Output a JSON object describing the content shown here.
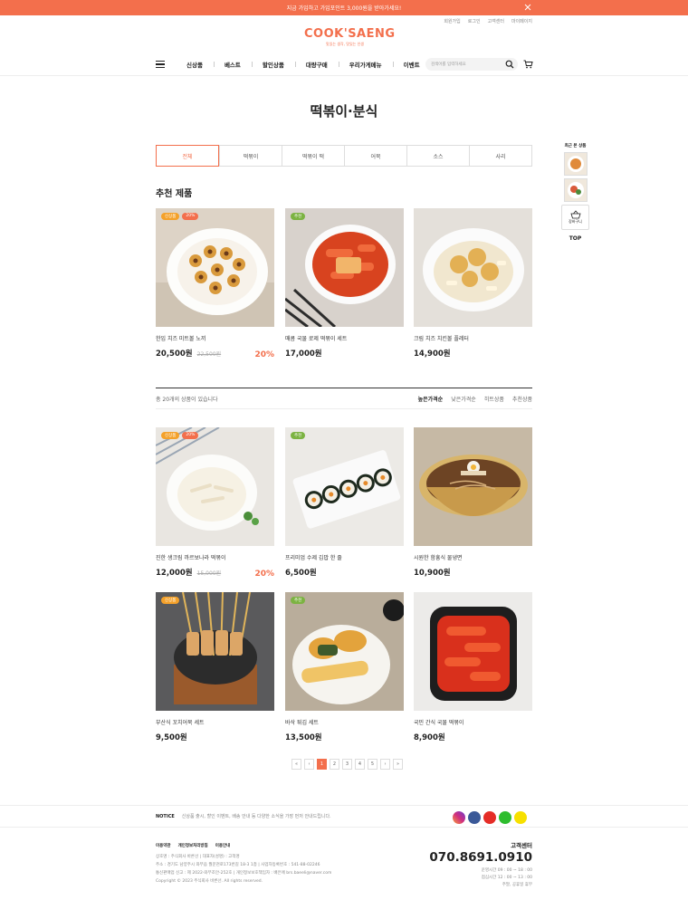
{
  "banner": {
    "text": "지금 가입하고 가입포인트 3,000원을 받아가세요!"
  },
  "util_links": [
    "회원가입",
    "로그인",
    "고객센터",
    "마이페이지"
  ],
  "logo": {
    "main": "COOK'SAENG",
    "sub": "맛있는 생각, 맛있는 인생"
  },
  "nav": [
    "신상품",
    "베스트",
    "할인상품",
    "대량구매",
    "우리가게메뉴",
    "이벤트"
  ],
  "search": {
    "placeholder": "검색어를 입력하세요"
  },
  "page_title": "떡볶이·분식",
  "tabs": [
    "전체",
    "떡볶이",
    "떡볶이 떡",
    "어묵",
    "소스",
    "사리"
  ],
  "rec_title": "추천 제품",
  "recommended": [
    {
      "name": "한입 치즈 미트볼 노끼",
      "price": "20,500원",
      "orig": "22,500원",
      "pct": "20%",
      "badges": [
        "신상품",
        "20%"
      ]
    },
    {
      "name": "매콤 국물 로제 떡볶이 세트",
      "price": "17,000원",
      "orig": "",
      "pct": "",
      "badges": [
        "추천"
      ]
    },
    {
      "name": "크림 치즈 치킨볼 플레터",
      "price": "14,900원",
      "orig": "",
      "pct": "",
      "badges": []
    }
  ],
  "count_text": "총 20개의 상품이 있습니다",
  "sorts": [
    "높은가격순",
    "낮은가격순",
    "히트상품",
    "추천상품"
  ],
  "products": [
    {
      "name": "진한 생크림 까르보나라 떡볶이",
      "price": "12,000원",
      "orig": "15,000원",
      "pct": "20%",
      "badges": [
        "신상품",
        "20%"
      ]
    },
    {
      "name": "프리미엄 수제 김밥 한 줄",
      "price": "6,500원",
      "orig": "",
      "pct": "",
      "badges": [
        "추천"
      ]
    },
    {
      "name": "시원한 함흥식 물냉면",
      "price": "10,900원",
      "orig": "",
      "pct": "",
      "badges": []
    },
    {
      "name": "부산식 꼬치어묵 세트",
      "price": "9,500원",
      "orig": "",
      "pct": "",
      "badges": [
        "신상품"
      ]
    },
    {
      "name": "바삭 튀김 세트",
      "price": "13,500원",
      "orig": "",
      "pct": "",
      "badges": [
        "추천"
      ]
    },
    {
      "name": "국민 간식 국물 떡볶이",
      "price": "8,900원",
      "orig": "",
      "pct": "",
      "badges": []
    }
  ],
  "paging": [
    "«",
    "‹",
    "1",
    "2",
    "3",
    "4",
    "5",
    "›",
    "»"
  ],
  "quick": {
    "label": "최근 본 상품",
    "cart": "장바구니",
    "top": "TOP"
  },
  "notice": {
    "label": "NOTICE",
    "text": "신상품 출시, 할인 이벤트, 배송 안내 등 다양한 소식을 가장 먼저 안내드립니다."
  },
  "footer": {
    "links": [
      "이용약관",
      "개인정보처리방침",
      "이용안내"
    ],
    "lines": [
      "상호명 : 주식회사 바른선   |   대표자(성명) : 고객명",
      "주소 : 경기도 남양주시 와부읍 월문천로173번길 18-3 1층   |   사업자등록번호 : 541-88-02246",
      "통신판매업 신고 : 제 2022-와부조안-252호   |   개인정보보호책임자 : 배은애 brs.baeeli@naver.com",
      "Copyright © 2023 주식회사 바른선. All rights reserved."
    ],
    "cs_title": "고객센터",
    "cs_number": "070.8691.0910",
    "cs_hours": [
      "운영시간   09 : 00 ~ 18 : 00",
      "점심시간   12 : 00 ~ 13 : 00",
      "주말, 공휴일 휴무"
    ]
  },
  "colors": {
    "accent": "#f36f4c"
  }
}
